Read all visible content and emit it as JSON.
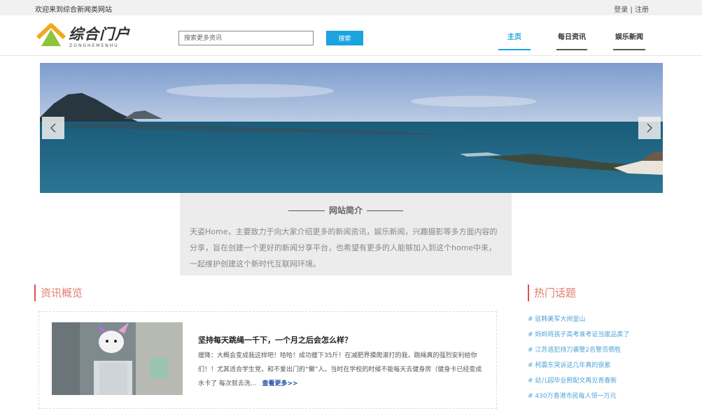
{
  "topbar": {
    "welcome": "欢迎来到综合新闻类网站",
    "login": "登录",
    "separator": " | ",
    "register": "注册"
  },
  "logo": {
    "brand": "综合门户",
    "pinyin": "ZONGHEMENHU",
    "icon": "house-logo-icon"
  },
  "search": {
    "placeholder": "搜索更多资讯",
    "button": "搜索"
  },
  "nav": {
    "items": [
      {
        "label": "主页",
        "active": true
      },
      {
        "label": "每日资讯",
        "active": false
      },
      {
        "label": "娱乐新闻",
        "active": false
      }
    ]
  },
  "banner": {
    "prev_icon": "chevron-left-icon",
    "next_icon": "chevron-right-icon"
  },
  "intro": {
    "title": "网站简介",
    "text": "天姿Home，主要致力于向大家介绍更多的新闻资讯，娱乐新闻，兴趣摄影等多方面内容的分享，旨在创建一个更好的新闻分享平台，也希望有更多的人能够加入到这个home中来，一起维护创建这个新时代互联网环境。"
  },
  "news_section": {
    "title": "资讯概览"
  },
  "article": {
    "headline": "坚持每天跳绳一千下，一个月之后会怎么样？",
    "summary": "瘦降：大概会变成我这样吧！哈哈！成功瘦下35斤！在减肥界摸爬滚打的我，跳绳真的强烈安利给你们！！尤其适合学生党，和不爱出门的“懒”人。当时在学校的时候不能每天去健身房（健身卡已经变成水卡了 每次就去洗...",
    "more": "查看更多>>"
  },
  "hot_section": {
    "title": "热门话题",
    "items": [
      "# 驻韩美军大闹釜山",
      "# 妈妈将孩子高考准考证当废品卖了",
      "# 江苏逃犯持刀袭警2名警员牺牲",
      "# 柯震东哭诉这几年真的很累",
      "# 幼儿园毕业照配文再见青春新",
      "# 430万香港市民每人领一万元"
    ]
  },
  "colors": {
    "accent": "#1aa3df",
    "section": "#d9534f",
    "hot_link": "#4fa3d6"
  }
}
